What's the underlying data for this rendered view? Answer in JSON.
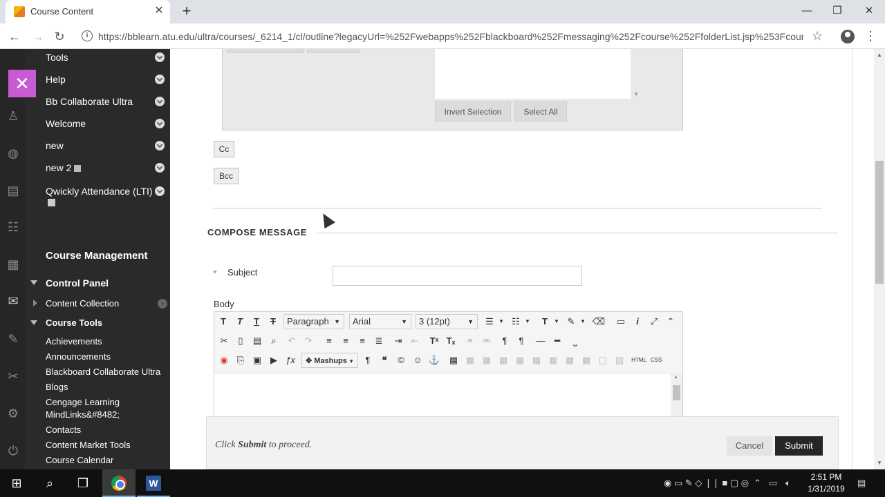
{
  "browser": {
    "tab_title": "Course Content",
    "url": "https://bblearn.atu.edu/ultra/courses/_6214_1/cl/outline?legacyUrl=%252Fwebapps%252Fblackboard%252Fmessaging%252Fcourse%252FfolderList.jsp%253Fcours..."
  },
  "course_menu": {
    "top_items": [
      {
        "label": "Tools"
      },
      {
        "label": "Help"
      },
      {
        "label": "Bb Collaborate Ultra"
      },
      {
        "label": "Welcome"
      },
      {
        "label": "new"
      },
      {
        "label": "new 2"
      },
      {
        "label": "Qwickly Attendance (LTI)"
      }
    ],
    "course_management": "Course Management",
    "control_panel": "Control Panel",
    "content_collection": "Content Collection",
    "course_tools": "Course Tools",
    "tool_items": [
      {
        "label": "Achievements"
      },
      {
        "label": "Announcements"
      },
      {
        "label": "Blackboard Collaborate Ultra"
      },
      {
        "label": "Blogs"
      },
      {
        "label": "Cengage Learning"
      },
      {
        "label": "MindLinks&#8482;"
      },
      {
        "label": "Contacts"
      },
      {
        "label": "Content Market Tools"
      },
      {
        "label": "Course Calendar"
      }
    ]
  },
  "recipients": {
    "invert_selection": "Invert Selection",
    "select_all": "Select All",
    "cc": "Cc",
    "bcc": "Bcc"
  },
  "compose": {
    "heading": "COMPOSE MESSAGE",
    "subject_required": "*",
    "subject_label": "Subject",
    "subject_value": "",
    "body_label": "Body"
  },
  "editor": {
    "paragraph": "Paragraph",
    "font": "Arial",
    "size": "3 (12pt)",
    "mashups": "Mashups",
    "html": "HTML",
    "css": "CSS"
  },
  "submit_bar": {
    "message_pre": "Click ",
    "message_bold": "Submit",
    "message_post": " to proceed.",
    "cancel": "Cancel",
    "submit": "Submit"
  },
  "taskbar": {
    "time": "2:51 PM",
    "date": "1/31/2019"
  },
  "colors": {
    "accent_purple": "#c85bd1",
    "menu_bg": "#2a2a2a",
    "submit_bg": "#262626",
    "required_star": "#e07b39"
  }
}
